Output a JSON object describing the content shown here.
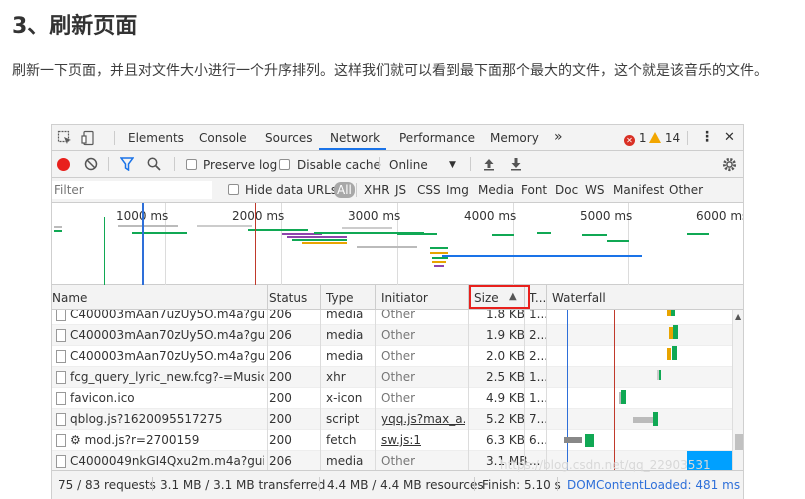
{
  "article": {
    "title": "3、刷新页面",
    "paragraph": "刷新一下页面，并且对文件大小进行一个升序排列。这样我们就可以看到最下面那个最大的文件，这个就是该音乐的文件。"
  },
  "devtools": {
    "tabs": [
      "Elements",
      "Console",
      "Sources",
      "Network",
      "Performance",
      "Memory"
    ],
    "active_tab": "Network",
    "more_tabs": "»",
    "errors": "1",
    "warnings": "14",
    "menu_icon": "⋮",
    "close_icon": "✕",
    "toolbar": {
      "preserve_log": "Preserve log",
      "disable_cache": "Disable cache",
      "throttle": "Online",
      "throttle_arrow": "▼"
    },
    "filter": {
      "placeholder": "Filter",
      "hide_data_urls": "Hide data URLs",
      "types": [
        "All",
        "XHR",
        "JS",
        "CSS",
        "Img",
        "Media",
        "Font",
        "Doc",
        "WS",
        "Manifest",
        "Other"
      ]
    },
    "ruler": [
      "1000 ms",
      "2000 ms",
      "3000 ms",
      "4000 ms",
      "5000 ms",
      "6000 ms"
    ],
    "columns": {
      "name": "Name",
      "status": "Status",
      "type": "Type",
      "initiator": "Initiator",
      "size": "Size",
      "size_sort": "▲",
      "time": "T...",
      "waterfall": "Waterfall"
    },
    "rows": [
      {
        "name": "C400003mAan7uzUy5O.m4a?guid...",
        "status": "206",
        "type": "media",
        "initiator": "Other",
        "size": "1.8 KB",
        "time": "1..."
      },
      {
        "name": "C400003mAan70zUy5O.m4a?guid...",
        "status": "206",
        "type": "media",
        "initiator": "Other",
        "size": "1.9 KB",
        "time": "2..."
      },
      {
        "name": "C400003mAan70zUy5O.m4a?guid...",
        "status": "206",
        "type": "media",
        "initiator": "Other",
        "size": "2.0 KB",
        "time": "2..."
      },
      {
        "name": "fcg_query_lyric_new.fcg?-=MusicJ...",
        "status": "200",
        "type": "xhr",
        "initiator": "Other",
        "size": "2.5 KB",
        "time": "1..."
      },
      {
        "name": "favicon.ico",
        "status": "200",
        "type": "x-icon",
        "initiator": "Other",
        "size": "4.9 KB",
        "time": "1..."
      },
      {
        "name": "qblog.js?1620095517275",
        "status": "200",
        "type": "script",
        "initiator": "yqq.js?max_a...",
        "size": "5.2 KB",
        "time": "7..."
      },
      {
        "name": "⚙ mod.js?r=2700159",
        "status": "200",
        "type": "fetch",
        "initiator": "sw.js:1",
        "size": "6.3 KB",
        "time": "6..."
      },
      {
        "name": "C4000049nkGI4Qxu2m.m4a?guid...",
        "status": "206",
        "type": "media",
        "initiator": "Other",
        "size": "3.1 MB",
        "time": "..."
      }
    ],
    "status_bar": {
      "requests": "75 / 83 requests",
      "transferred": "3.1 MB / 3.1 MB transferred",
      "resources": "4.4 MB / 4.4 MB resources",
      "finish": "Finish: 5.10 s",
      "dom": "DOMContentLoaded: 481 ms"
    },
    "colors": {
      "accent": "#1a73e8",
      "record": "#e8201c",
      "dom_line": "#2e6fd9",
      "load_line": "#c0392b",
      "bar_green": "#10a854",
      "bar_blue": "#00a0ff"
    }
  },
  "watermark": "https://blog.csdn.net/qq_22903531"
}
